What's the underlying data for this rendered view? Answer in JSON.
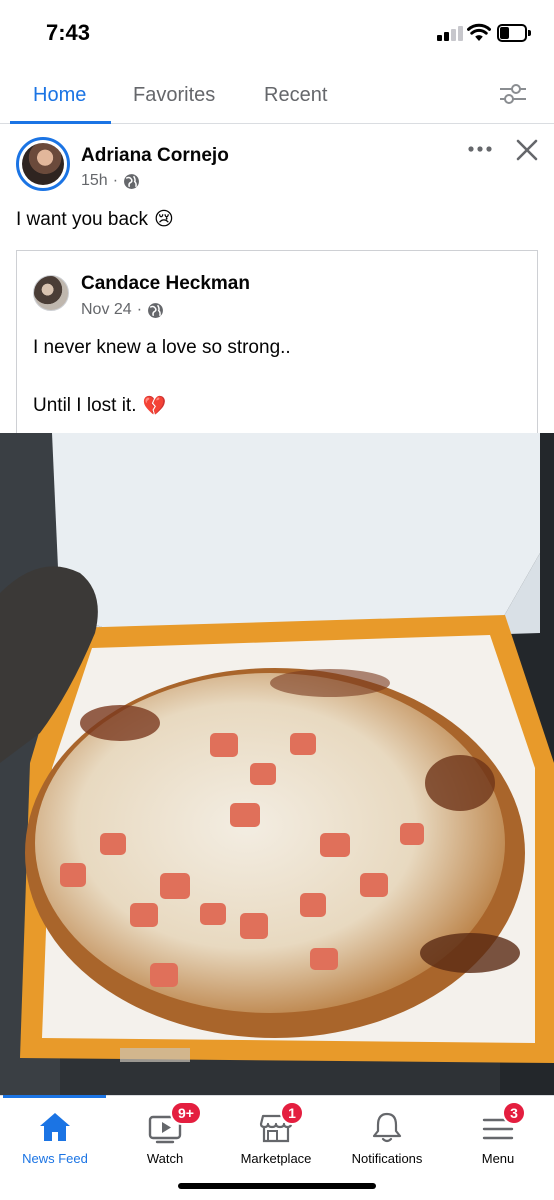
{
  "status_bar": {
    "time": "7:43"
  },
  "feed_tabs": [
    {
      "label": "Home",
      "active": true
    },
    {
      "label": "Favorites",
      "active": false
    },
    {
      "label": "Recent",
      "active": false
    }
  ],
  "post": {
    "author": "Adriana Cornejo",
    "time": "15h",
    "text": "I want you back",
    "emoji": "😢",
    "shared": {
      "author": "Candace Heckman",
      "date": "Nov 24",
      "line1": "I never knew a love so strong..",
      "line2": "Until I lost it.",
      "line2_emoji": "💔"
    }
  },
  "bottom_nav": {
    "items": [
      {
        "label": "News Feed",
        "icon": "home-icon",
        "badge": "",
        "active": true
      },
      {
        "label": "Watch",
        "icon": "watch-icon",
        "badge": "9+",
        "active": false
      },
      {
        "label": "Marketplace",
        "icon": "marketplace-icon",
        "badge": "1",
        "active": false
      },
      {
        "label": "Notifications",
        "icon": "bell-icon",
        "badge": "",
        "active": false
      },
      {
        "label": "Menu",
        "icon": "menu-icon",
        "badge": "3",
        "active": false
      }
    ]
  },
  "colors": {
    "accent": "#1b74e4",
    "badge": "#e41e3f",
    "secondary_text": "#65676b"
  }
}
